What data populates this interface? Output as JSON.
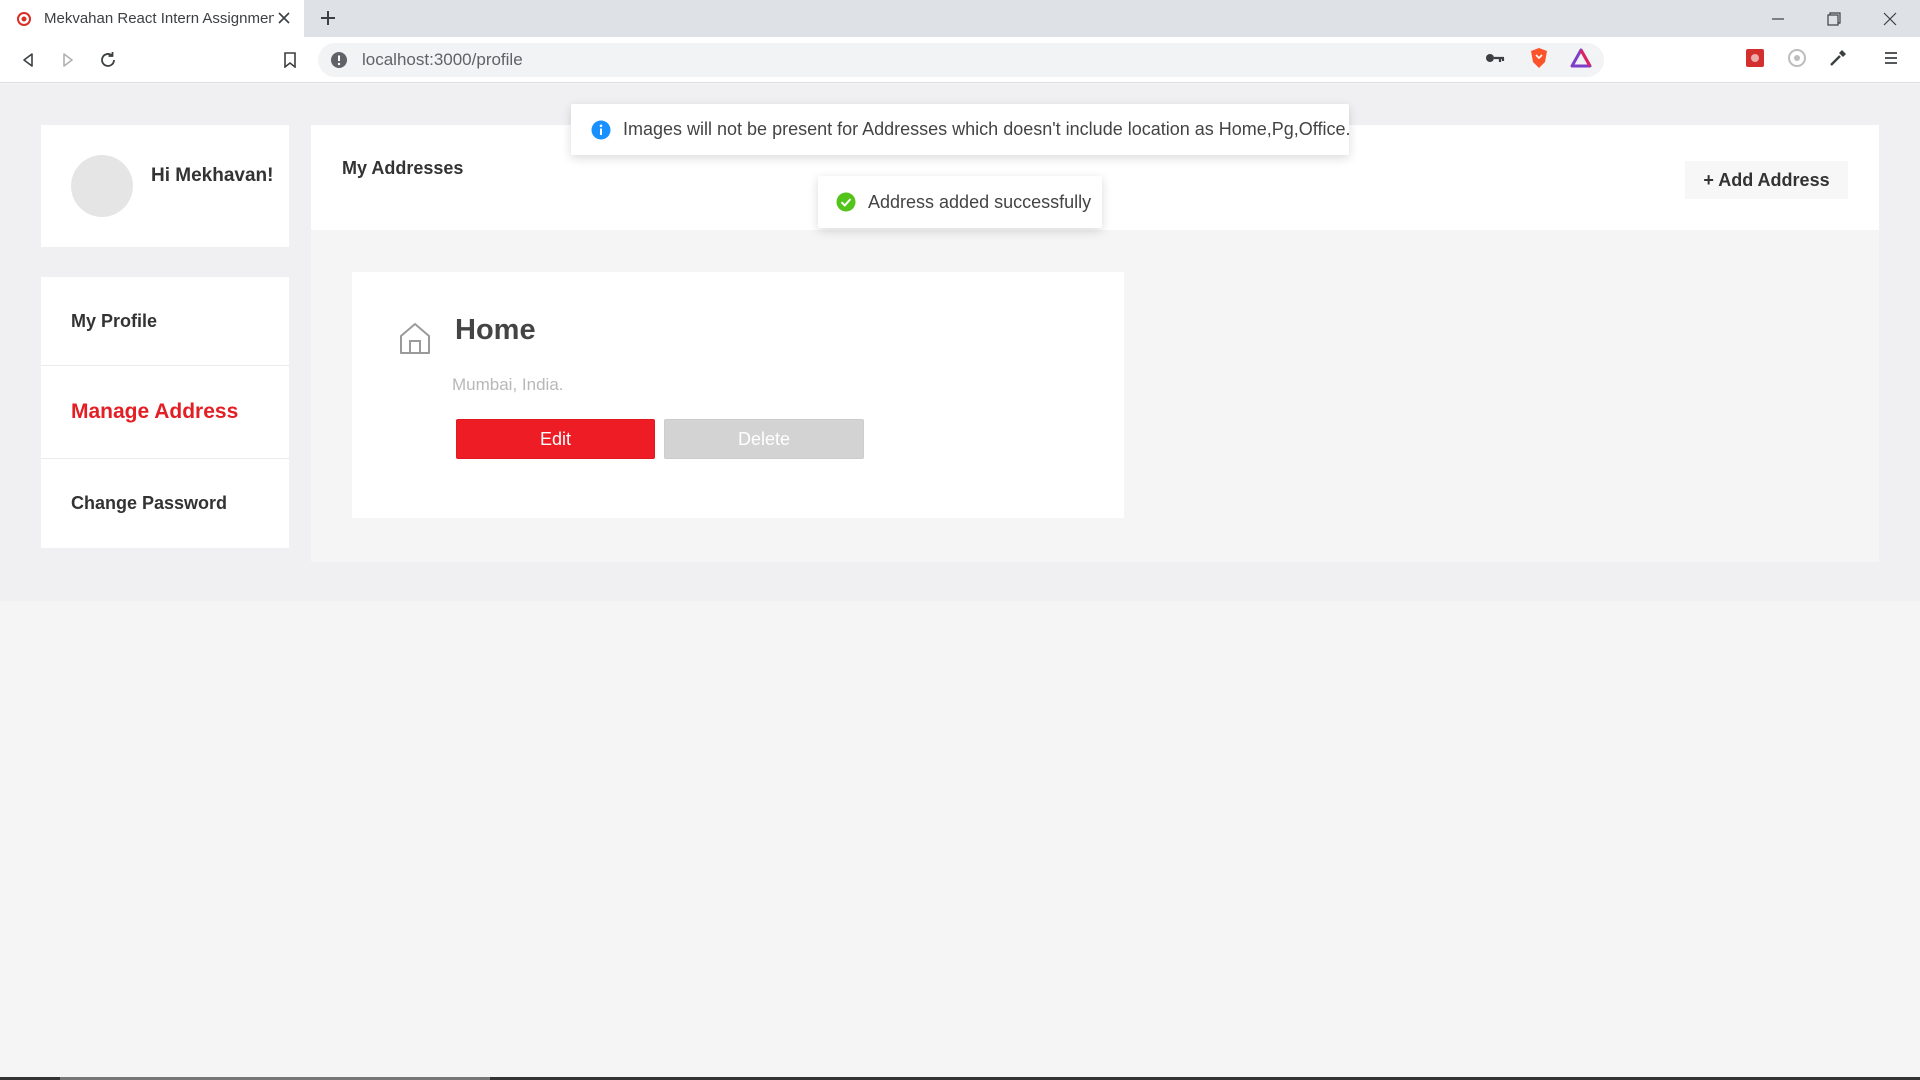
{
  "browser": {
    "tab_title": "Mekvahan React Intern Assignment",
    "url": "localhost:3000/profile"
  },
  "sidebar": {
    "greeting": "Hi Mekhavan!",
    "items": [
      {
        "label": "My Profile",
        "active": false
      },
      {
        "label": "Manage Address",
        "active": true
      },
      {
        "label": "Change Password",
        "active": false
      }
    ]
  },
  "main": {
    "title": "My Addresses",
    "add_button": "+ Add Address",
    "addresses": [
      {
        "title": "Home",
        "location": "Mumbai, India.",
        "edit_label": "Edit",
        "delete_label": "Delete"
      }
    ]
  },
  "toasts": {
    "info": "Images will not be present for Addresses which doesn't include location as Home,Pg,Office.",
    "success": "Address added successfully"
  },
  "colors": {
    "accent": "#ee1c25",
    "info": "#1890ff",
    "success": "#52c41a"
  },
  "icons": {
    "address_card": "home-icon",
    "info_toast": "info-icon",
    "success_toast": "check-circle-icon"
  }
}
